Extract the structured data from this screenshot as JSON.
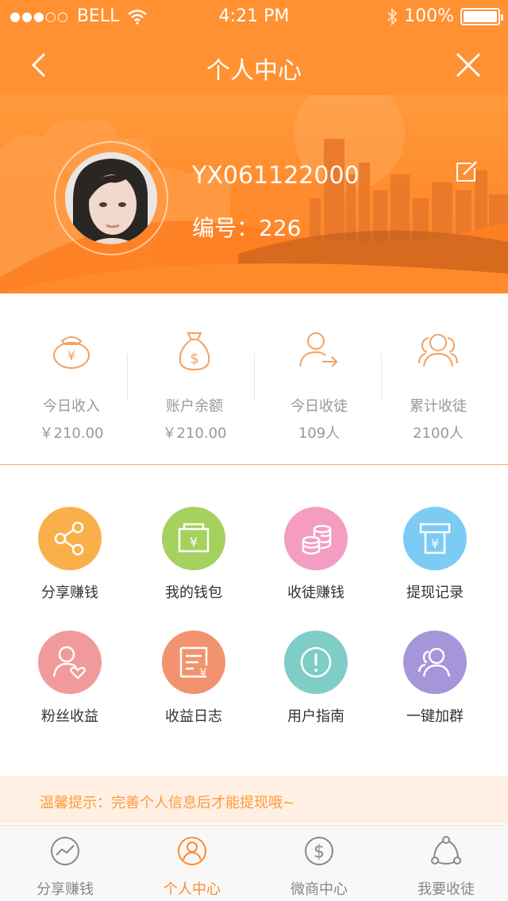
{
  "status_bar": {
    "signal": "●●●○○",
    "carrier": "BELL",
    "time": "4:21 PM",
    "battery": "100%",
    "battery_level": 1.0
  },
  "nav": {
    "title": "个人中心",
    "back_icon": "chevron-left-icon",
    "close_icon": "close-icon"
  },
  "profile": {
    "username": "YX061122000",
    "id_line": "编号：226",
    "edit_icon": "edit-icon"
  },
  "stats": [
    {
      "icon": "money-bag-yen-icon",
      "label": "今日收入",
      "value": "￥210.00"
    },
    {
      "icon": "money-bag-dollar-icon",
      "label": "账户余额",
      "value": "￥210.00"
    },
    {
      "icon": "add-follower-icon",
      "label": "今日收徒",
      "value": "109人"
    },
    {
      "icon": "group-icon",
      "label": "累计收徒",
      "value": "2100人"
    }
  ],
  "grid": [
    {
      "label": "分享赚钱",
      "color": "#f9b04a",
      "icon": "share-icon"
    },
    {
      "label": "我的钱包",
      "color": "#a5d15e",
      "icon": "wallet-icon"
    },
    {
      "label": "收徒赚钱",
      "color": "#f49cc2",
      "icon": "coins-icon"
    },
    {
      "label": "提现记录",
      "color": "#7ccbf5",
      "icon": "withdraw-icon"
    },
    {
      "label": "粉丝收益",
      "color": "#f19a9c",
      "icon": "fan-icon"
    },
    {
      "label": "收益日志",
      "color": "#f2936d",
      "icon": "log-icon"
    },
    {
      "label": "用户指南",
      "color": "#7ecdc6",
      "icon": "guide-icon"
    },
    {
      "label": "一键加群",
      "color": "#a596d9",
      "icon": "join-group-icon"
    }
  ],
  "tip": "温馨提示：完善个人信息后才能提现哦~",
  "tabs": [
    {
      "label": "分享赚钱",
      "icon": "chart-icon",
      "active": false
    },
    {
      "label": "个人中心",
      "icon": "user-icon",
      "active": true
    },
    {
      "label": "微商中心",
      "icon": "dollar-icon",
      "active": false
    },
    {
      "label": "我要收徒",
      "icon": "network-icon",
      "active": false
    }
  ],
  "colors": {
    "accent": "#ff8a2c",
    "header": "#ff9132",
    "tip_bg": "#fff0e3"
  }
}
